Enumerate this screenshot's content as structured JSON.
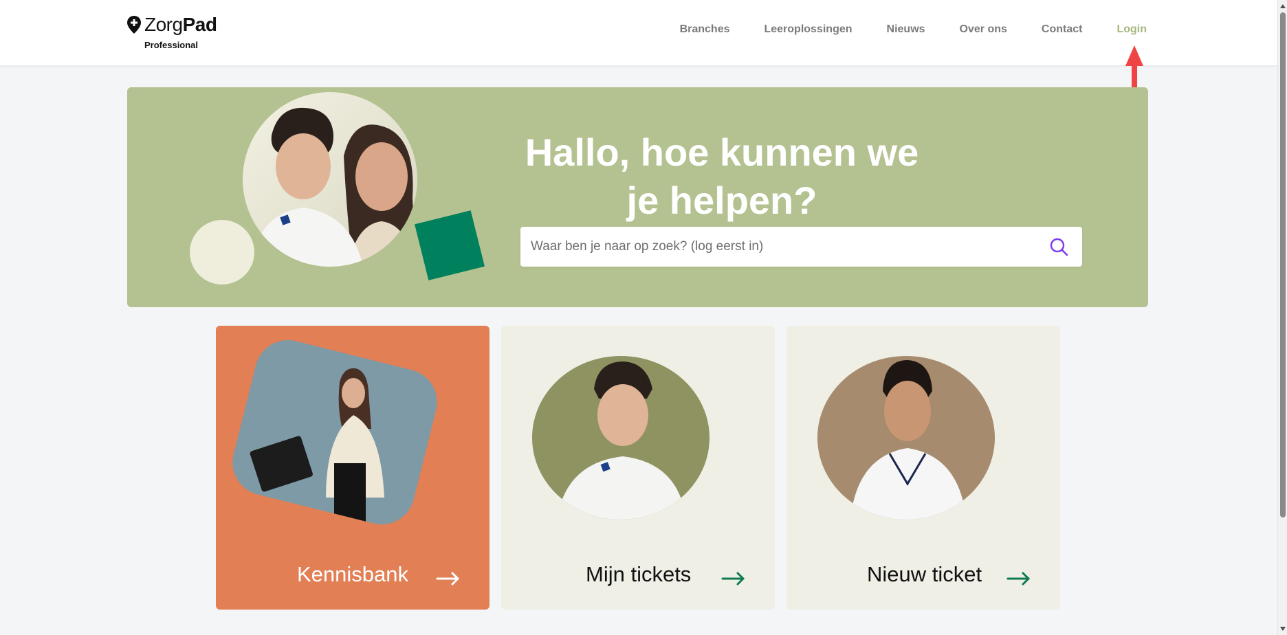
{
  "brand": {
    "name_light": "Zorg",
    "name_bold": "Pad",
    "subtitle": "Professional"
  },
  "nav": {
    "items": [
      {
        "label": "Branches"
      },
      {
        "label": "Leeroplossingen"
      },
      {
        "label": "Nieuws"
      },
      {
        "label": "Over ons"
      },
      {
        "label": "Contact"
      },
      {
        "label": "Login"
      }
    ]
  },
  "hero": {
    "title": "Hallo, hoe kunnen we je helpen?",
    "search_placeholder": "Waar ben je naar op zoek? (log eerst in)"
  },
  "cards": [
    {
      "label": "Kennisbank"
    },
    {
      "label": "Mijn tickets"
    },
    {
      "label": "Nieuw ticket"
    }
  ],
  "colors": {
    "hero_bg": "#b3c290",
    "login_accent": "#a6b77f",
    "card_primary": "#e27f54",
    "card_neutral": "#efefe6",
    "arrow_green": "#0e7a52",
    "search_icon": "#7c3aed",
    "annotation": "#ef4444"
  },
  "icons": {
    "logo": "location-pin-icon",
    "search": "search-icon",
    "card_arrow": "arrow-right-icon"
  }
}
